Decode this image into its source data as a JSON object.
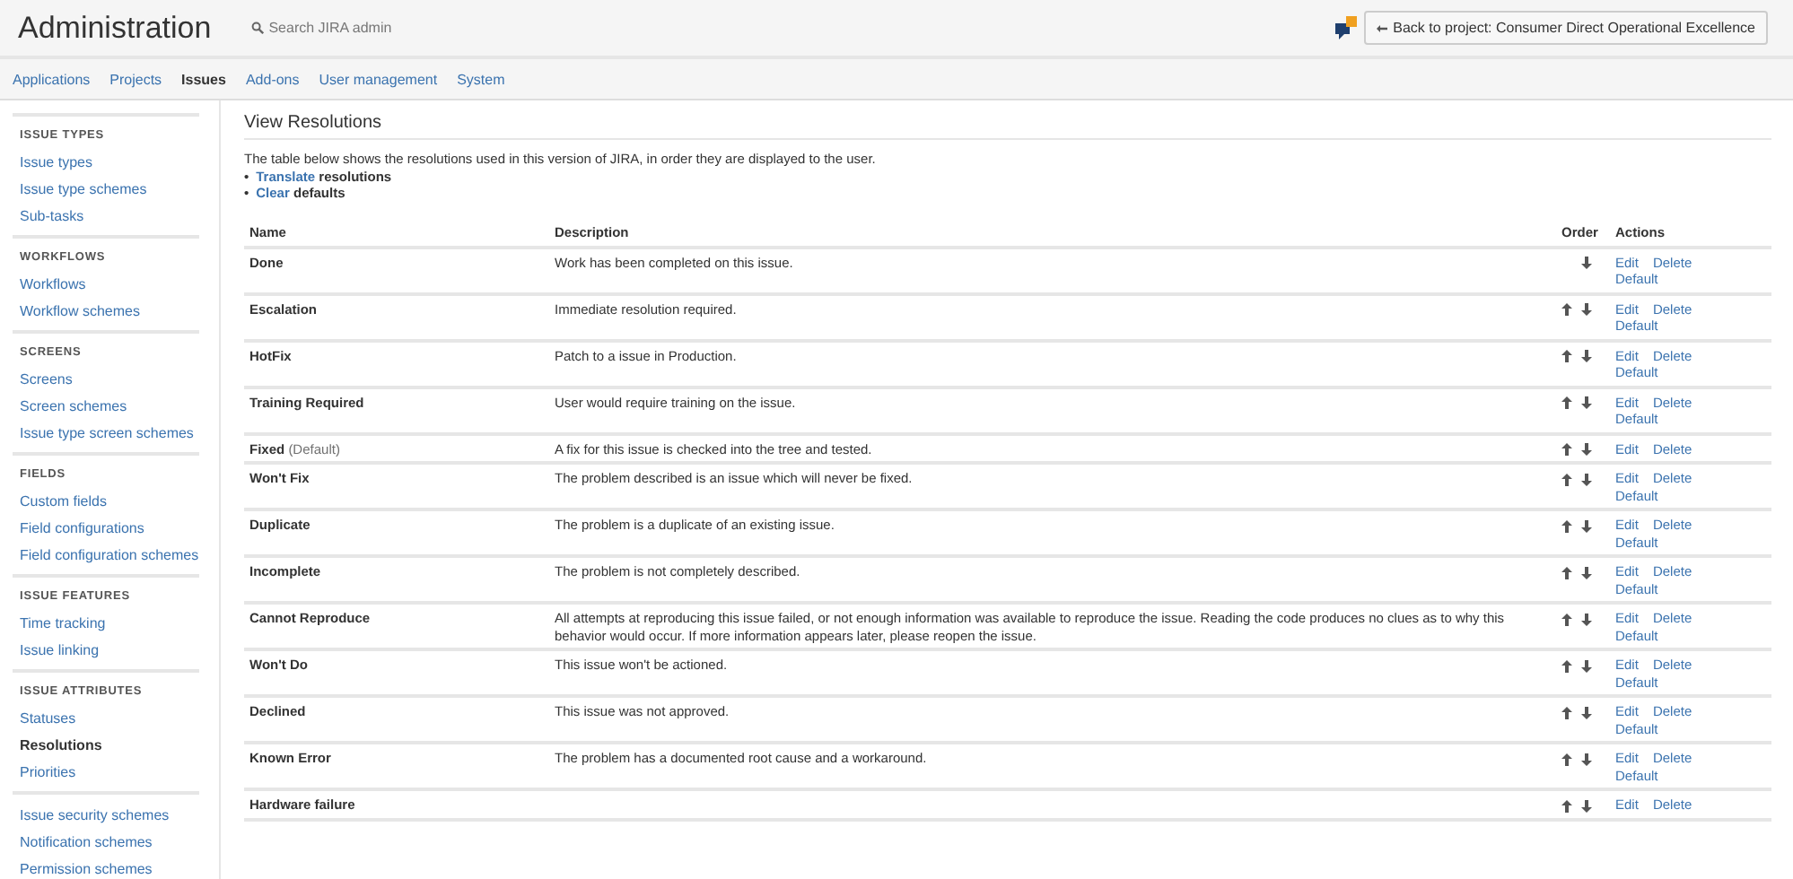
{
  "header": {
    "title": "Administration",
    "search": {
      "placeholder": "Search JIRA admin"
    },
    "back_button": "Back to project: Consumer Direct Operational Excellence"
  },
  "nav": [
    {
      "label": "Applications",
      "selected": false
    },
    {
      "label": "Projects",
      "selected": false
    },
    {
      "label": "Issues",
      "selected": true
    },
    {
      "label": "Add-ons",
      "selected": false
    },
    {
      "label": "User management",
      "selected": false
    },
    {
      "label": "System",
      "selected": false
    }
  ],
  "sidebar": [
    {
      "heading": "ISSUE TYPES",
      "items": [
        {
          "label": "Issue types",
          "selected": false
        },
        {
          "label": "Issue type schemes",
          "selected": false
        },
        {
          "label": "Sub-tasks",
          "selected": false
        }
      ]
    },
    {
      "heading": "WORKFLOWS",
      "items": [
        {
          "label": "Workflows",
          "selected": false
        },
        {
          "label": "Workflow schemes",
          "selected": false
        }
      ]
    },
    {
      "heading": "SCREENS",
      "items": [
        {
          "label": "Screens",
          "selected": false
        },
        {
          "label": "Screen schemes",
          "selected": false
        },
        {
          "label": "Issue type screen schemes",
          "selected": false
        }
      ]
    },
    {
      "heading": "FIELDS",
      "items": [
        {
          "label": "Custom fields",
          "selected": false
        },
        {
          "label": "Field configurations",
          "selected": false
        },
        {
          "label": "Field configuration schemes",
          "selected": false
        }
      ]
    },
    {
      "heading": "ISSUE FEATURES",
      "items": [
        {
          "label": "Time tracking",
          "selected": false
        },
        {
          "label": "Issue linking",
          "selected": false
        }
      ]
    },
    {
      "heading": "ISSUE ATTRIBUTES",
      "items": [
        {
          "label": "Statuses",
          "selected": false
        },
        {
          "label": "Resolutions",
          "selected": true
        },
        {
          "label": "Priorities",
          "selected": false
        }
      ]
    },
    {
      "items": [
        {
          "label": "Issue security schemes",
          "selected": false
        },
        {
          "label": "Notification schemes",
          "selected": false
        },
        {
          "label": "Permission schemes",
          "selected": false
        }
      ]
    }
  ],
  "page": {
    "title": "View Resolutions",
    "intro": "The table below shows the resolutions used in this version of JIRA, in order they are displayed to the user.",
    "links": [
      {
        "marker": "•",
        "link": "Translate",
        "text": "resolutions"
      },
      {
        "marker": "•",
        "link": "Clear",
        "text": "defaults"
      }
    ]
  },
  "table": {
    "columns": [
      "Name",
      "Description",
      "Order",
      "Actions"
    ],
    "rows": [
      {
        "name": "Done",
        "description": "Work has been completed on this issue.",
        "up": false,
        "down": true,
        "actions": [
          "Edit",
          "Delete",
          "Default"
        ]
      },
      {
        "name": "Escalation",
        "description": "Immediate resolution required.",
        "up": true,
        "down": true,
        "actions": [
          "Edit",
          "Delete",
          "Default"
        ]
      },
      {
        "name": "HotFix",
        "description": "Patch to a issue in Production.",
        "up": true,
        "down": true,
        "actions": [
          "Edit",
          "Delete",
          "Default"
        ]
      },
      {
        "name": "Training Required",
        "description": "User would require training on the issue.",
        "up": true,
        "down": true,
        "actions": [
          "Edit",
          "Delete",
          "Default"
        ]
      },
      {
        "name": "Fixed",
        "tag": "(Default)",
        "description": "A fix for this issue is checked into the tree and tested.",
        "up": true,
        "down": true,
        "actions": [
          "Edit",
          "Delete"
        ]
      },
      {
        "name": "Won't Fix",
        "description": "The problem described is an issue which will never be fixed.",
        "up": true,
        "down": true,
        "actions": [
          "Edit",
          "Delete",
          "Default"
        ]
      },
      {
        "name": "Duplicate",
        "description": "The problem is a duplicate of an existing issue.",
        "up": true,
        "down": true,
        "actions": [
          "Edit",
          "Delete",
          "Default"
        ]
      },
      {
        "name": "Incomplete",
        "description": "The problem is not completely described.",
        "up": true,
        "down": true,
        "actions": [
          "Edit",
          "Delete",
          "Default"
        ]
      },
      {
        "name": "Cannot Reproduce",
        "description": "All attempts at reproducing this issue failed, or not enough information was available to reproduce the issue. Reading the code produces no clues as to why this behavior would occur. If more information appears later, please reopen the issue.",
        "up": true,
        "down": true,
        "actions": [
          "Edit",
          "Delete",
          "Default"
        ]
      },
      {
        "name": "Won't Do",
        "description": "This issue won't be actioned.",
        "up": true,
        "down": true,
        "actions": [
          "Edit",
          "Delete",
          "Default"
        ]
      },
      {
        "name": "Declined",
        "description": "This issue was not approved.",
        "up": true,
        "down": true,
        "actions": [
          "Edit",
          "Delete",
          "Default"
        ]
      },
      {
        "name": "Known Error",
        "description": "The problem has a documented root cause and a workaround.",
        "up": true,
        "down": true,
        "actions": [
          "Edit",
          "Delete",
          "Default"
        ]
      },
      {
        "name": "Hardware failure",
        "up": true,
        "down": true,
        "actions": [
          "Edit",
          "Delete"
        ]
      }
    ]
  }
}
